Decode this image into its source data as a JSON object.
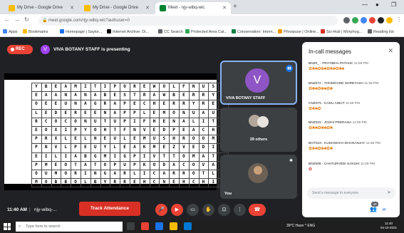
{
  "browser": {
    "tabs": [
      {
        "label": "My Drive - Google Drive",
        "active": false
      },
      {
        "label": "My Drive - Google Drive",
        "active": false
      },
      {
        "label": "Meet - njy-wibq-wic",
        "active": true
      }
    ],
    "url": "meet.google.com/njy-wibq-wic?authuser=0",
    "bookmarks": [
      "Apps",
      "Bookmarks",
      "Homepage | Saylor...",
      "Internet Archive: Di...",
      "CC Search",
      "Protected Area Cat...",
      "Conservation: Intern...",
      "Phnopuse | Online...",
      "Sci-Hub | Morphog...",
      "Reading list"
    ]
  },
  "meet": {
    "rec_label": "REC",
    "presenter_initial": "V",
    "presenting_text": "VIVA BOTANY STAFF is presenting",
    "puzzle": {
      "rows": [
        "YBEAMITIPOREWOLFNUSI",
        "EAANANABESTRAWBERRYE",
        "OEEUNAGRAPECHERRYREC",
        "LEDEREENAPPLEMONUAU",
        "RCOCONUTUPIFHENALIT",
        "EOXIPYOHTFNVEDPEACHT",
        "PRXLELHEULEMUSHROOME",
        "PNVLPEUYLEAKMEZVEDIL",
        "EILIABGMIGPIVTTOMATO",
        "PMEOTATOPUPKODACOVAW",
        "OUMORINGARLICARROTLR",
        "MOBBOLBYRREHCNEHCHIQ"
      ]
    },
    "tiles": {
      "main_initial": "V",
      "main_name": "VIVA BOTANY STAFF",
      "others_label": "39 others",
      "self_label": "You"
    },
    "chat": {
      "title": "In-call messages",
      "messages": [
        {
          "name": "BNZ0_ - PRATIBHA PATHAK",
          "time": "11:59 PM",
          "emoji": "✿❀♣✿❀♣✿❀♣✿❀♣"
        },
        {
          "name": "BNZ074 - THOMGARE SHREYASH",
          "time": "11:59 PM",
          "emoji": "✿❀♣✿❀♣✿❀"
        },
        {
          "name": "CNZ075 - KADU ANKIT",
          "time": "11:59 PM",
          "emoji": "✿❀♣✿"
        },
        {
          "name": "BNZ033 - JOSHI PRERANA",
          "time": "11:59 PM",
          "emoji": "✿❀♣✿❀♣✿❀"
        },
        {
          "name": "BOT018 - KUSHWAHA DHANANJAY",
          "time": "11:59 PM",
          "emoji": "✿❀♣✿❀♣✿❀"
        },
        {
          "name": "BNZ008 - CHATURVEDI SAKSHI",
          "time": "11:59 PM",
          "emoji": "✿"
        }
      ],
      "input_placeholder": "Send a message to everyone"
    },
    "controls": {
      "clock": "11:40 AM",
      "meeting_code": "njy-wibq-...",
      "track_button": "Track Attendance",
      "participant_count": "40"
    }
  },
  "taskbar": {
    "search_placeholder": "Type here to search",
    "tray": "39°C Haze  ^  ENG",
    "time": "11:40",
    "date": "04-10-2021"
  },
  "colors": {
    "meet_bg": "#202124",
    "rec_red": "#ea4335",
    "track_red": "#d93025",
    "avatar_purple": "#8e55c4",
    "active_border": "#8ab4f8"
  }
}
